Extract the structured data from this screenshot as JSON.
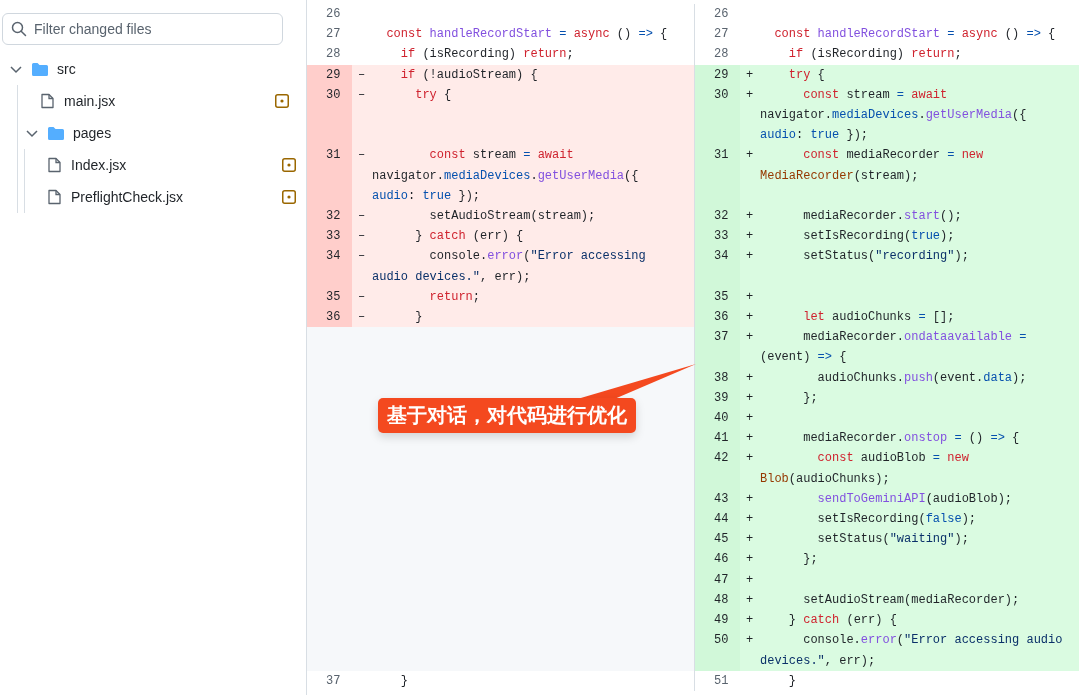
{
  "sidebar": {
    "filter": {
      "placeholder": "Filter changed files"
    },
    "tree": [
      {
        "kind": "folder",
        "name": "src",
        "expanded": true,
        "children": [
          {
            "kind": "file",
            "name": "main.jsx",
            "modified": true
          },
          {
            "kind": "folder",
            "name": "pages",
            "expanded": true,
            "children": [
              {
                "kind": "file",
                "name": "Index.jsx",
                "modified": true
              },
              {
                "kind": "file",
                "name": "PreflightCheck.jsx",
                "modified": true
              }
            ]
          }
        ]
      }
    ]
  },
  "diff": {
    "rows": [
      {
        "left": {
          "num": "26",
          "kind": "context"
        },
        "right": {
          "num": "26",
          "kind": "context"
        }
      },
      {
        "left": {
          "num": "27",
          "kind": "context",
          "code": [
            [
              {
                "text": "  const ",
                "kind": "keyword"
              },
              {
                "text": "handleRecordStart",
                "kind": "function"
              },
              {
                "text": " = ",
                "kind": "constant"
              },
              {
                "text": "async",
                "kind": "keyword"
              },
              {
                "text": " () ",
                "kind": "plain"
              },
              {
                "text": "=>",
                "kind": "constant"
              },
              {
                "text": " {",
                "kind": "plain"
              }
            ]
          ]
        },
        "right": {
          "num": "27",
          "kind": "context",
          "code": [
            [
              {
                "text": "  const ",
                "kind": "keyword"
              },
              {
                "text": "handleRecordStart",
                "kind": "function"
              },
              {
                "text": " = ",
                "kind": "constant"
              },
              {
                "text": "async",
                "kind": "keyword"
              },
              {
                "text": " () ",
                "kind": "plain"
              },
              {
                "text": "=>",
                "kind": "constant"
              },
              {
                "text": " {",
                "kind": "plain"
              }
            ]
          ]
        }
      },
      {
        "left": {
          "num": "28",
          "kind": "context",
          "code": [
            [
              {
                "text": "    if",
                "kind": "keyword"
              },
              {
                "text": " (isRecording) ",
                "kind": "plain"
              },
              {
                "text": "return",
                "kind": "keyword"
              },
              {
                "text": ";",
                "kind": "plain"
              }
            ]
          ]
        },
        "right": {
          "num": "28",
          "kind": "context",
          "code": [
            [
              {
                "text": "    if",
                "kind": "keyword"
              },
              {
                "text": " (isRecording) ",
                "kind": "plain"
              },
              {
                "text": "return",
                "kind": "keyword"
              },
              {
                "text": ";",
                "kind": "plain"
              }
            ]
          ]
        }
      },
      {
        "left": {
          "num": "29",
          "kind": "removed",
          "sign": "–",
          "code": [
            [
              {
                "text": "    if",
                "kind": "keyword"
              },
              {
                "text": " (!audioStream) {",
                "kind": "plain"
              }
            ]
          ]
        },
        "right": {
          "num": "29",
          "kind": "added",
          "sign": "+",
          "code": [
            [
              {
                "text": "    try",
                "kind": "keyword"
              },
              {
                "text": " {",
                "kind": "plain"
              }
            ]
          ]
        }
      },
      {
        "left": {
          "num": "30",
          "kind": "removed",
          "sign": "–",
          "code": [
            [
              {
                "text": "      try",
                "kind": "keyword"
              },
              {
                "text": " {",
                "kind": "plain"
              }
            ]
          ]
        },
        "right": {
          "num": "30",
          "kind": "added",
          "sign": "+",
          "code": [
            [
              {
                "text": "      const",
                "kind": "keyword"
              },
              {
                "text": " stream ",
                "kind": "plain"
              },
              {
                "text": "= ",
                "kind": "constant"
              },
              {
                "text": "await",
                "kind": "keyword"
              }
            ],
            [
              {
                "text": "navigator.",
                "kind": "plain"
              },
              {
                "text": "mediaDevices",
                "kind": "constant"
              },
              {
                "text": ".",
                "kind": "plain"
              },
              {
                "text": "getUserMedia",
                "kind": "function"
              },
              {
                "text": "({",
                "kind": "plain"
              }
            ],
            [
              {
                "text": "audio",
                "kind": "constant"
              },
              {
                "text": ": ",
                "kind": "plain"
              },
              {
                "text": "true",
                "kind": "constant"
              },
              {
                "text": " });",
                "kind": "plain"
              }
            ]
          ]
        }
      },
      {
        "left": {
          "num": "31",
          "kind": "removed",
          "sign": "–",
          "code": [
            [
              {
                "text": "        const",
                "kind": "keyword"
              },
              {
                "text": " stream ",
                "kind": "plain"
              },
              {
                "text": "= ",
                "kind": "constant"
              },
              {
                "text": "await",
                "kind": "keyword"
              }
            ],
            [
              {
                "text": "navigator.",
                "kind": "plain"
              },
              {
                "text": "mediaDevices",
                "kind": "constant"
              },
              {
                "text": ".",
                "kind": "plain"
              },
              {
                "text": "getUserMedia",
                "kind": "function"
              },
              {
                "text": "({",
                "kind": "plain"
              }
            ],
            [
              {
                "text": "audio",
                "kind": "constant"
              },
              {
                "text": ": ",
                "kind": "plain"
              },
              {
                "text": "true",
                "kind": "constant"
              },
              {
                "text": " });",
                "kind": "plain"
              }
            ]
          ]
        },
        "right": {
          "num": "31",
          "kind": "added",
          "sign": "+",
          "code": [
            [
              {
                "text": "      const",
                "kind": "keyword"
              },
              {
                "text": " mediaRecorder ",
                "kind": "plain"
              },
              {
                "text": "= ",
                "kind": "constant"
              },
              {
                "text": "new",
                "kind": "keyword"
              }
            ],
            [
              {
                "text": "MediaRecorder",
                "kind": "type"
              },
              {
                "text": "(stream);",
                "kind": "plain"
              }
            ]
          ]
        }
      },
      {
        "left": {
          "num": "32",
          "kind": "removed",
          "sign": "–",
          "code": [
            [
              {
                "text": "        setAudioStream(stream);",
                "kind": "plain"
              }
            ]
          ]
        },
        "right": {
          "num": "32",
          "kind": "added",
          "sign": "+",
          "code": [
            [
              {
                "text": "      mediaRecorder.",
                "kind": "plain"
              },
              {
                "text": "start",
                "kind": "function"
              },
              {
                "text": "();",
                "kind": "plain"
              }
            ]
          ]
        }
      },
      {
        "left": {
          "num": "33",
          "kind": "removed",
          "sign": "–",
          "code": [
            [
              {
                "text": "      } ",
                "kind": "plain"
              },
              {
                "text": "catch",
                "kind": "keyword"
              },
              {
                "text": " (err) {",
                "kind": "plain"
              }
            ]
          ]
        },
        "right": {
          "num": "33",
          "kind": "added",
          "sign": "+",
          "code": [
            [
              {
                "text": "      setIsRecording(",
                "kind": "plain"
              },
              {
                "text": "true",
                "kind": "constant"
              },
              {
                "text": ");",
                "kind": "plain"
              }
            ]
          ]
        }
      },
      {
        "left": {
          "num": "34",
          "kind": "removed",
          "sign": "–",
          "code": [
            [
              {
                "text": "        console.",
                "kind": "plain"
              },
              {
                "text": "error",
                "kind": "function"
              },
              {
                "text": "(",
                "kind": "plain"
              },
              {
                "text": "\"Error accessing",
                "kind": "string"
              }
            ],
            [
              {
                "text": "audio devices.\"",
                "kind": "string"
              },
              {
                "text": ", err);",
                "kind": "plain"
              }
            ]
          ]
        },
        "right": {
          "num": "34",
          "kind": "added",
          "sign": "+",
          "code": [
            [
              {
                "text": "      setStatus(",
                "kind": "plain"
              },
              {
                "text": "\"recording\"",
                "kind": "string"
              },
              {
                "text": ");",
                "kind": "plain"
              }
            ]
          ]
        }
      },
      {
        "left": {
          "num": "35",
          "kind": "removed",
          "sign": "–",
          "code": [
            [
              {
                "text": "        return",
                "kind": "keyword"
              },
              {
                "text": ";",
                "kind": "plain"
              }
            ]
          ]
        },
        "right": {
          "num": "35",
          "kind": "added",
          "sign": "+"
        }
      },
      {
        "left": {
          "num": "36",
          "kind": "removed",
          "sign": "–",
          "code": [
            [
              {
                "text": "      }",
                "kind": "plain"
              }
            ]
          ]
        },
        "right": {
          "num": "36",
          "kind": "added",
          "sign": "+",
          "code": [
            [
              {
                "text": "      let",
                "kind": "keyword"
              },
              {
                "text": " audioChunks ",
                "kind": "plain"
              },
              {
                "text": "=",
                "kind": "constant"
              },
              {
                "text": " [];",
                "kind": "plain"
              }
            ]
          ]
        }
      },
      {
        "right": {
          "num": "37",
          "kind": "added",
          "sign": "+",
          "code": [
            [
              {
                "text": "      mediaRecorder.",
                "kind": "plain"
              },
              {
                "text": "ondataavailable",
                "kind": "function"
              },
              {
                "text": " =",
                "kind": "constant"
              }
            ],
            [
              {
                "text": "(event) ",
                "kind": "plain"
              },
              {
                "text": "=>",
                "kind": "constant"
              },
              {
                "text": " {",
                "kind": "plain"
              }
            ]
          ]
        }
      },
      {
        "right": {
          "num": "38",
          "kind": "added",
          "sign": "+",
          "code": [
            [
              {
                "text": "        audioChunks.",
                "kind": "plain"
              },
              {
                "text": "push",
                "kind": "function"
              },
              {
                "text": "(event.",
                "kind": "plain"
              },
              {
                "text": "data",
                "kind": "constant"
              },
              {
                "text": ");",
                "kind": "plain"
              }
            ]
          ]
        }
      },
      {
        "right": {
          "num": "39",
          "kind": "added",
          "sign": "+",
          "code": [
            [
              {
                "text": "      };",
                "kind": "plain"
              }
            ]
          ]
        }
      },
      {
        "right": {
          "num": "40",
          "kind": "added",
          "sign": "+"
        }
      },
      {
        "right": {
          "num": "41",
          "kind": "added",
          "sign": "+",
          "code": [
            [
              {
                "text": "      mediaRecorder.",
                "kind": "plain"
              },
              {
                "text": "onstop",
                "kind": "function"
              },
              {
                "text": " = ",
                "kind": "constant"
              },
              {
                "text": "() ",
                "kind": "plain"
              },
              {
                "text": "=>",
                "kind": "constant"
              },
              {
                "text": " {",
                "kind": "plain"
              }
            ]
          ]
        }
      },
      {
        "right": {
          "num": "42",
          "kind": "added",
          "sign": "+",
          "code": [
            [
              {
                "text": "        const",
                "kind": "keyword"
              },
              {
                "text": " audioBlob ",
                "kind": "plain"
              },
              {
                "text": "= ",
                "kind": "constant"
              },
              {
                "text": "new",
                "kind": "keyword"
              }
            ],
            [
              {
                "text": "Blob",
                "kind": "type"
              },
              {
                "text": "(audioChunks);",
                "kind": "plain"
              }
            ]
          ]
        }
      },
      {
        "right": {
          "num": "43",
          "kind": "added",
          "sign": "+",
          "code": [
            [
              {
                "text": "        sendToGeminiAPI",
                "kind": "function"
              },
              {
                "text": "(audioBlob);",
                "kind": "plain"
              }
            ]
          ]
        }
      },
      {
        "right": {
          "num": "44",
          "kind": "added",
          "sign": "+",
          "code": [
            [
              {
                "text": "        setIsRecording(",
                "kind": "plain"
              },
              {
                "text": "false",
                "kind": "constant"
              },
              {
                "text": ");",
                "kind": "plain"
              }
            ]
          ]
        }
      },
      {
        "right": {
          "num": "45",
          "kind": "added",
          "sign": "+",
          "code": [
            [
              {
                "text": "        setStatus(",
                "kind": "plain"
              },
              {
                "text": "\"waiting\"",
                "kind": "string"
              },
              {
                "text": ");",
                "kind": "plain"
              }
            ]
          ]
        }
      },
      {
        "right": {
          "num": "46",
          "kind": "added",
          "sign": "+",
          "code": [
            [
              {
                "text": "      };",
                "kind": "plain"
              }
            ]
          ]
        }
      },
      {
        "right": {
          "num": "47",
          "kind": "added",
          "sign": "+"
        }
      },
      {
        "right": {
          "num": "48",
          "kind": "added",
          "sign": "+",
          "code": [
            [
              {
                "text": "      setAudioStream(mediaRecorder);",
                "kind": "plain"
              }
            ]
          ]
        }
      },
      {
        "right": {
          "num": "49",
          "kind": "added",
          "sign": "+",
          "code": [
            [
              {
                "text": "    } ",
                "kind": "plain"
              },
              {
                "text": "catch",
                "kind": "keyword"
              },
              {
                "text": " (err) {",
                "kind": "plain"
              }
            ]
          ]
        }
      },
      {
        "right": {
          "num": "50",
          "kind": "added",
          "sign": "+",
          "code": [
            [
              {
                "text": "      console.",
                "kind": "plain"
              },
              {
                "text": "error",
                "kind": "function"
              },
              {
                "text": "(",
                "kind": "plain"
              },
              {
                "text": "\"Error accessing audio",
                "kind": "string"
              }
            ],
            [
              {
                "text": "devices.\"",
                "kind": "string"
              },
              {
                "text": ", err);",
                "kind": "plain"
              }
            ]
          ]
        }
      },
      {
        "left": {
          "num": "37",
          "kind": "context",
          "code": [
            [
              {
                "text": "    }",
                "kind": "plain"
              }
            ]
          ]
        },
        "right": {
          "num": "51",
          "kind": "context",
          "code": [
            [
              {
                "text": "    }",
                "kind": "plain"
              }
            ]
          ]
        }
      }
    ]
  },
  "callout": {
    "text": "基于对话，对代码进行优化"
  }
}
